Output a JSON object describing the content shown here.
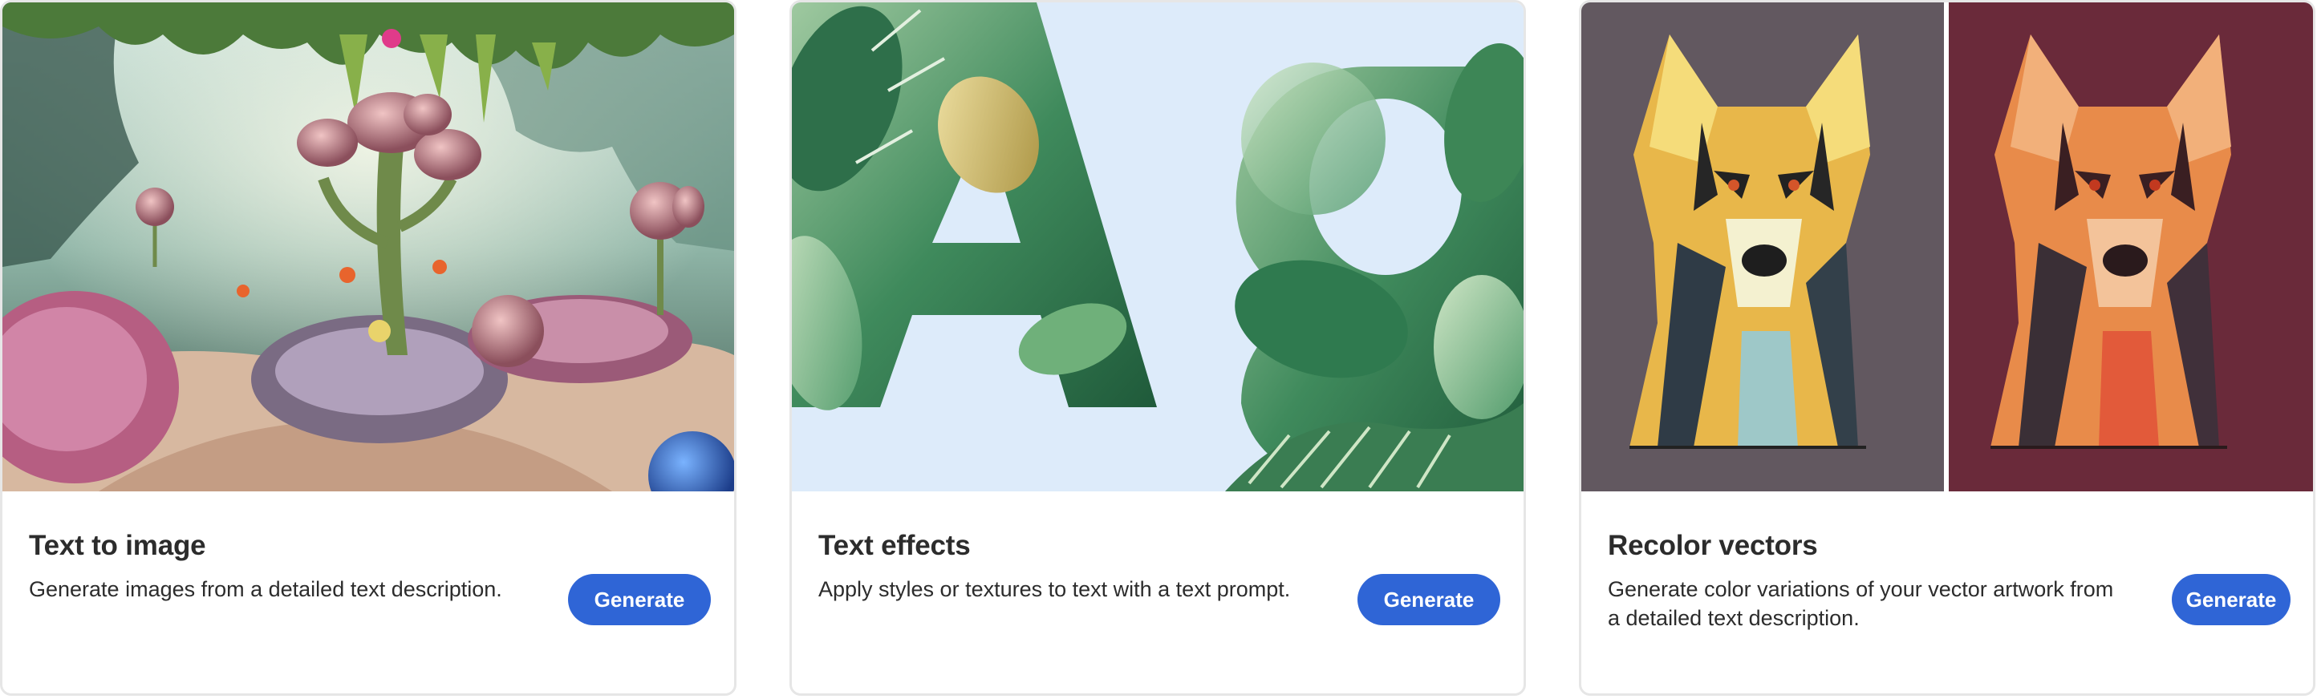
{
  "cards": [
    {
      "title": "Text to image",
      "description": "Generate images from a detailed text description.",
      "button_label": "Generate",
      "thumbnail_icon": "fantasy-garden-image"
    },
    {
      "title": "Text effects",
      "description": "Apply styles or textures to text with a text prompt.",
      "button_label": "Generate",
      "thumbnail_icon": "leaf-letters-image"
    },
    {
      "title": "Recolor vectors",
      "description": "Generate color variations of your vector artwork from a detailed text description.",
      "button_label": "Generate",
      "thumbnail_icon": "recolored-dog-vectors-image"
    }
  ],
  "colors": {
    "button_blue": "#2f65d6",
    "title_text": "#2c2c2c",
    "card_border": "#e6e6e6"
  }
}
